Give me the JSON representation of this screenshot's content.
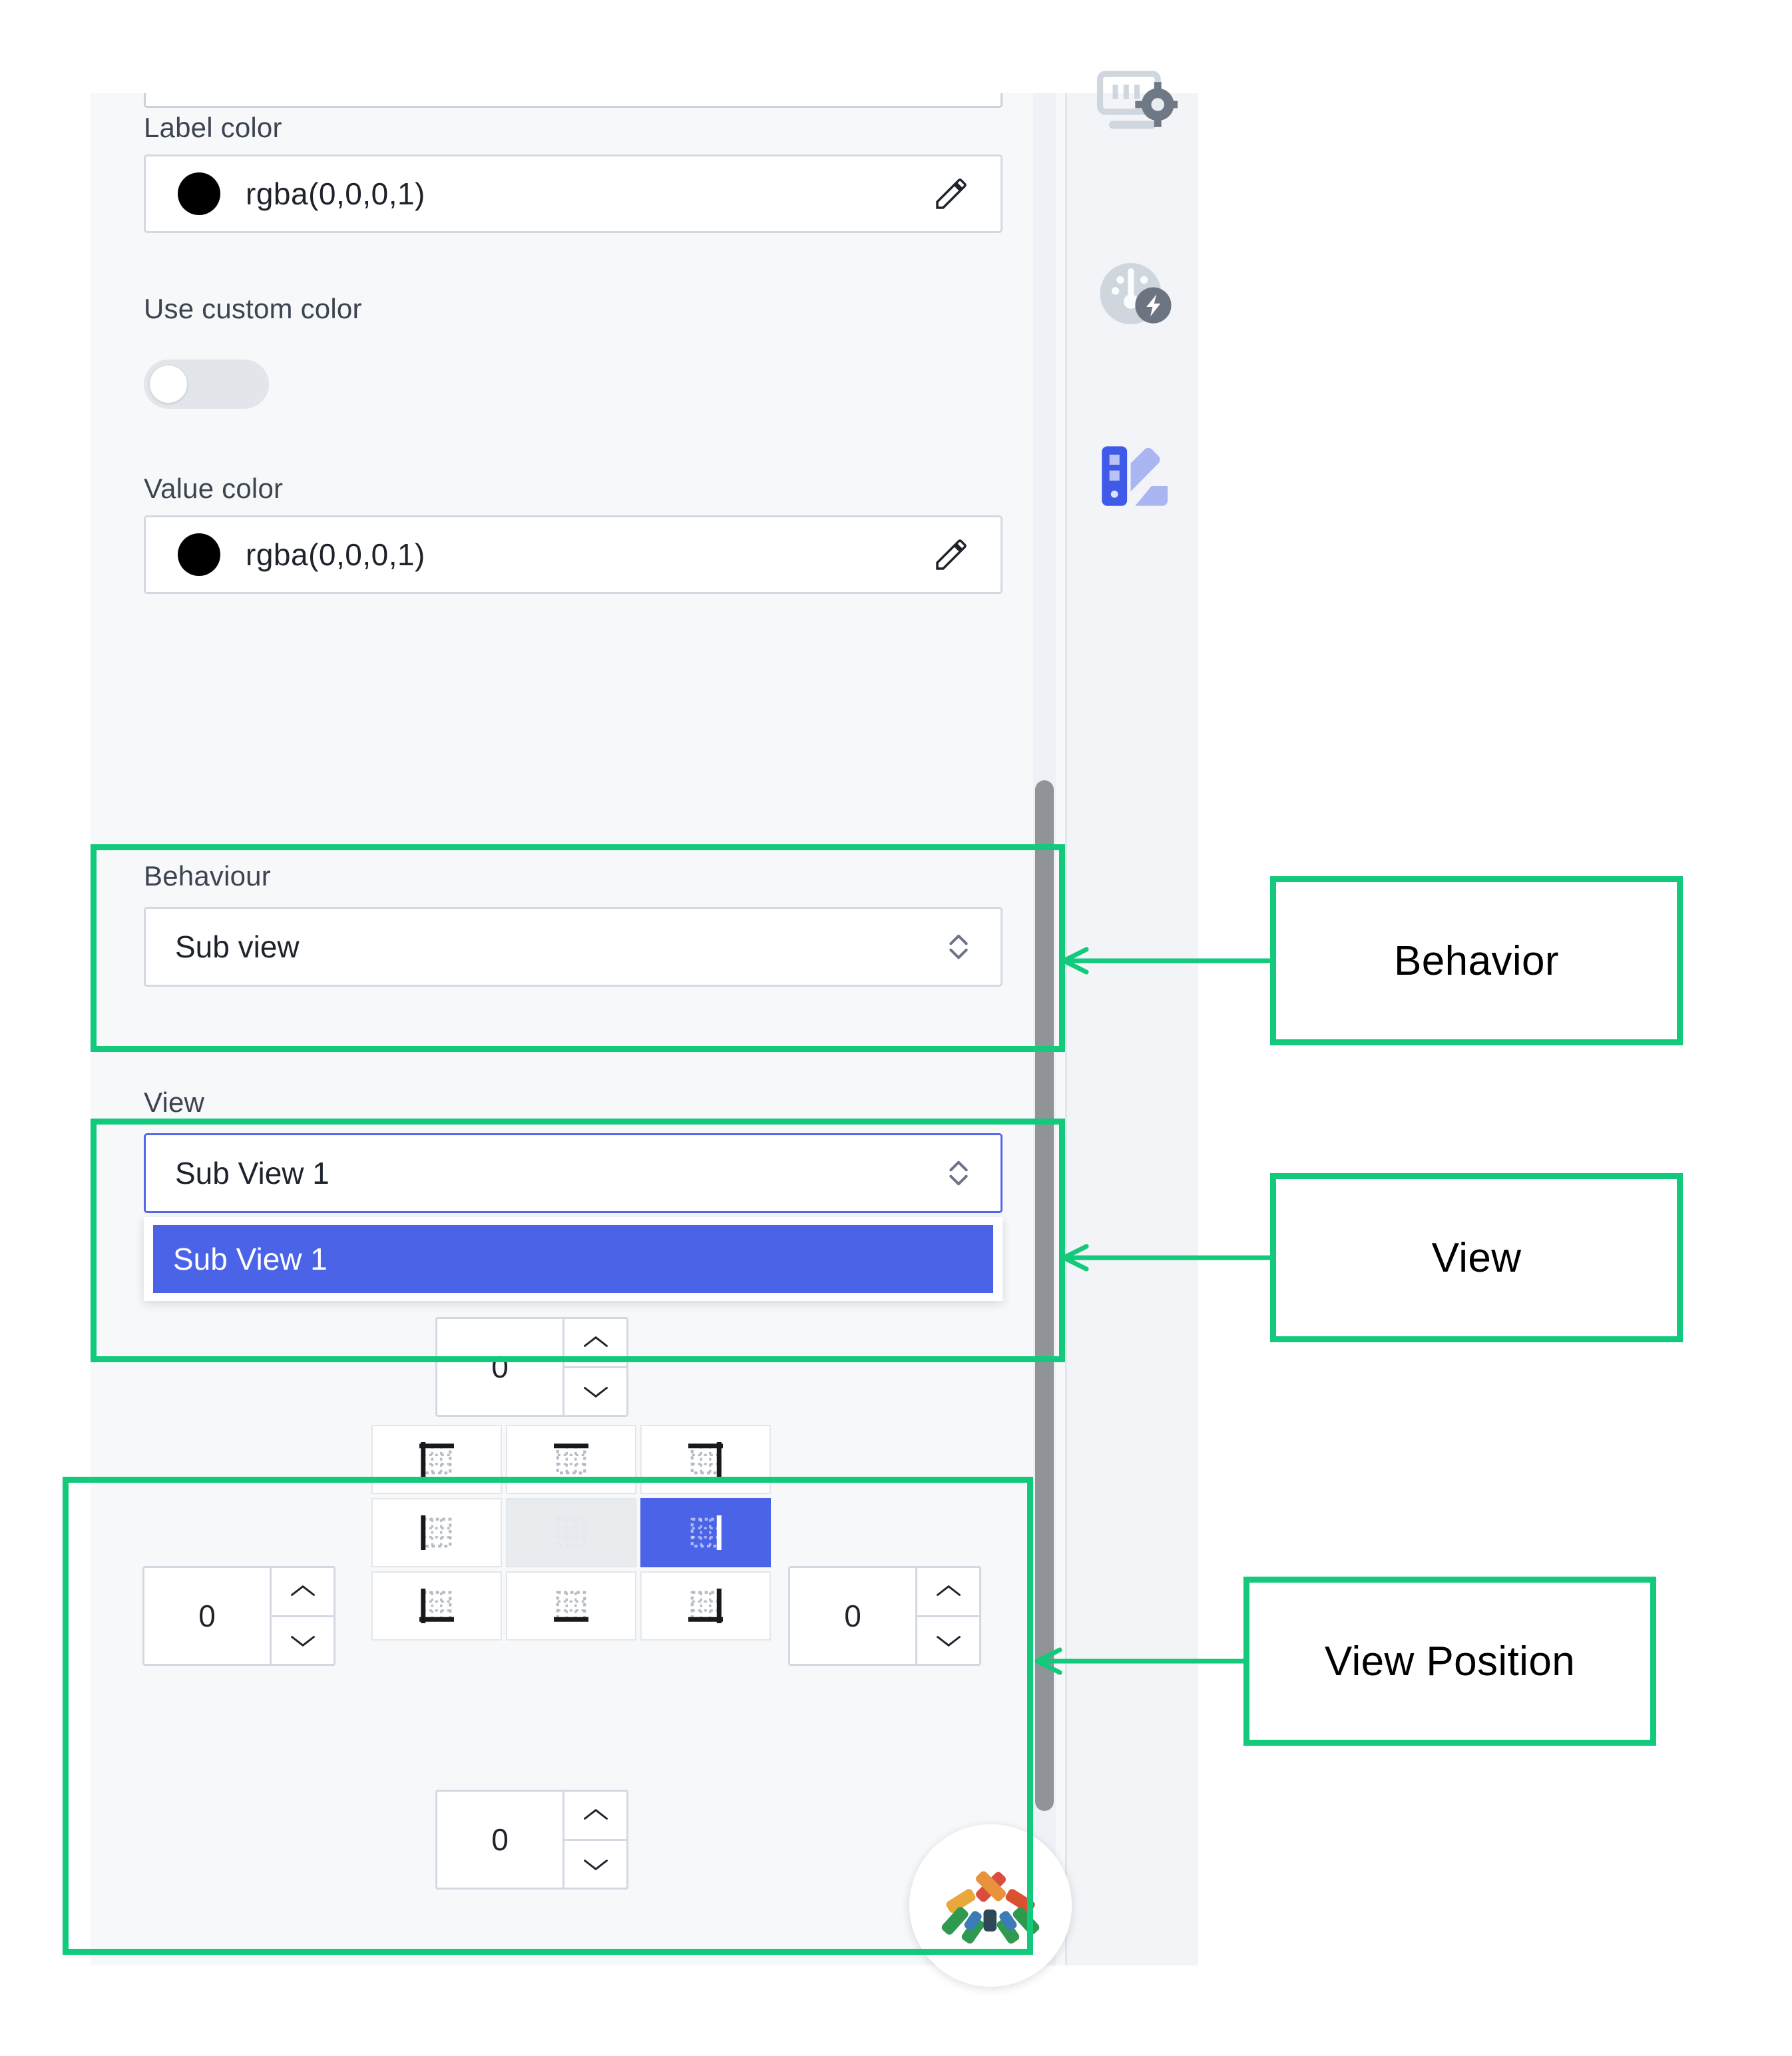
{
  "panel": {
    "fields": [
      {
        "label": "Label color",
        "value": "rgba(0,0,0,1)",
        "swatch": "#000000",
        "edit_icon": "pencil-icon"
      },
      {
        "label": "Use custom color",
        "toggle_state": "off"
      },
      {
        "label": "Value color",
        "value": "rgba(0,0,0,1)",
        "swatch": "#000000",
        "edit_icon": "pencil-icon"
      }
    ],
    "behaviour": {
      "label": "Behaviour",
      "value": "Sub view",
      "indicator_icon": "chevron-up-down-icon"
    },
    "view": {
      "label": "View",
      "value": "Sub View 1",
      "indicator_icon": "chevron-up-down-icon",
      "options": [
        "Sub View 1"
      ],
      "selected_option": "Sub View 1"
    },
    "position": {
      "top_offset": "0",
      "left_offset": "0",
      "right_offset": "0",
      "bottom_offset": "0",
      "spinner_up_icon": "chevron-up-icon",
      "spinner_down_icon": "chevron-down-icon",
      "cells": [
        {
          "name": "align-top-left",
          "icon": "corner-top-left-icon",
          "state": "normal"
        },
        {
          "name": "align-top-center",
          "icon": "edge-top-icon",
          "state": "normal"
        },
        {
          "name": "align-top-right",
          "icon": "corner-top-right-icon",
          "state": "normal"
        },
        {
          "name": "align-middle-left",
          "icon": "edge-left-icon",
          "state": "normal"
        },
        {
          "name": "align-middle-center",
          "icon": "center-icon",
          "state": "disabled"
        },
        {
          "name": "align-middle-right",
          "icon": "edge-right-icon",
          "state": "selected"
        },
        {
          "name": "align-bottom-left",
          "icon": "corner-bottom-left-icon",
          "state": "normal"
        },
        {
          "name": "align-bottom-center",
          "icon": "edge-bottom-icon",
          "state": "normal"
        },
        {
          "name": "align-bottom-right",
          "icon": "corner-bottom-right-icon",
          "state": "normal"
        }
      ]
    },
    "scrollbar": {
      "orientation": "vertical"
    }
  },
  "rail": {
    "items": [
      {
        "icon": "screen-settings-icon",
        "state": "inactive"
      },
      {
        "icon": "gauge-lightning-icon",
        "state": "inactive"
      },
      {
        "icon": "palette-style-icon",
        "state": "active"
      }
    ]
  },
  "logo": {
    "icon": "pinwheel-logo-icon"
  },
  "annotations": [
    {
      "label": "Behavior",
      "arrow": "arrow-left-icon"
    },
    {
      "label": "View",
      "arrow": "arrow-left-icon"
    },
    {
      "label": "View Position",
      "arrow": "arrow-left-icon"
    }
  ],
  "colors": {
    "annotation_green": "#12c97c",
    "accent_blue": "#4b63e6",
    "panel_bg": "#f6f8fa",
    "border": "#d3d9e2",
    "text": "#1d222b"
  }
}
